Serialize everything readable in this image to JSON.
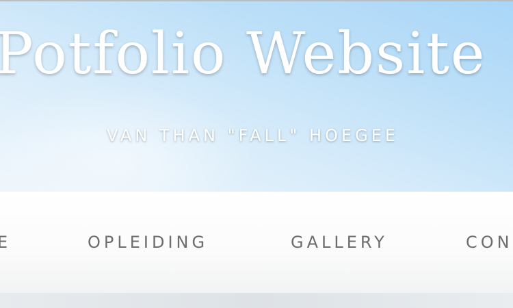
{
  "header": {
    "title": "Potfolio Website",
    "subtitle": "VAN THAN \"FALL\" HOEGEE"
  },
  "nav": {
    "items": [
      {
        "label": "E"
      },
      {
        "label": "OPLEIDING"
      },
      {
        "label": "GALLERY"
      },
      {
        "label": "CON"
      }
    ]
  },
  "colors": {
    "hero_sky": "#bcdff8",
    "title_text": "#ffffff",
    "nav_text": "#6d6d6d",
    "nav_background": "#ffffff"
  }
}
